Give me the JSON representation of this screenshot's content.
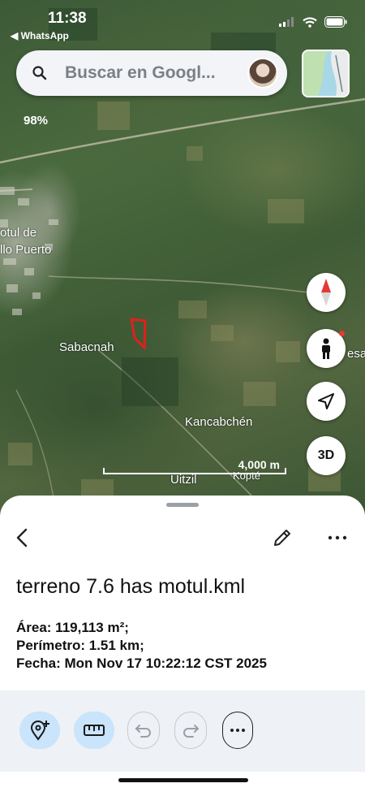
{
  "status_bar": {
    "time": "11:38",
    "back_app": "◀ WhatsApp"
  },
  "search": {
    "placeholder": "Buscar en Googl..."
  },
  "map": {
    "percent": "98%",
    "labels": {
      "motul": "otul de",
      "motul2": "llo Puerto",
      "sabacnah": "Sabacnah",
      "kancabchen": "Kancabchén",
      "uitzil": "Uitzil",
      "kopte": "Kopté",
      "esat": "esat"
    },
    "scale": "4,000 m",
    "polygon_color": "#e0201c"
  },
  "buttons": {
    "three_d": "3D"
  },
  "sheet": {
    "title": "terreno 7.6 has motul.kml",
    "area": "Área: 119,113 m²;",
    "perimeter": "Perímetro: 1.51 km;",
    "date": "Fecha: Mon Nov 17 10:22:12 CST 2025"
  },
  "toolbar": {
    "items": [
      "add-place-icon",
      "ruler-icon",
      "undo-icon",
      "redo-icon",
      "more-horizontal-icon"
    ]
  },
  "colors": {
    "accent": "#c9e4fb",
    "compass_red": "#e53935"
  }
}
